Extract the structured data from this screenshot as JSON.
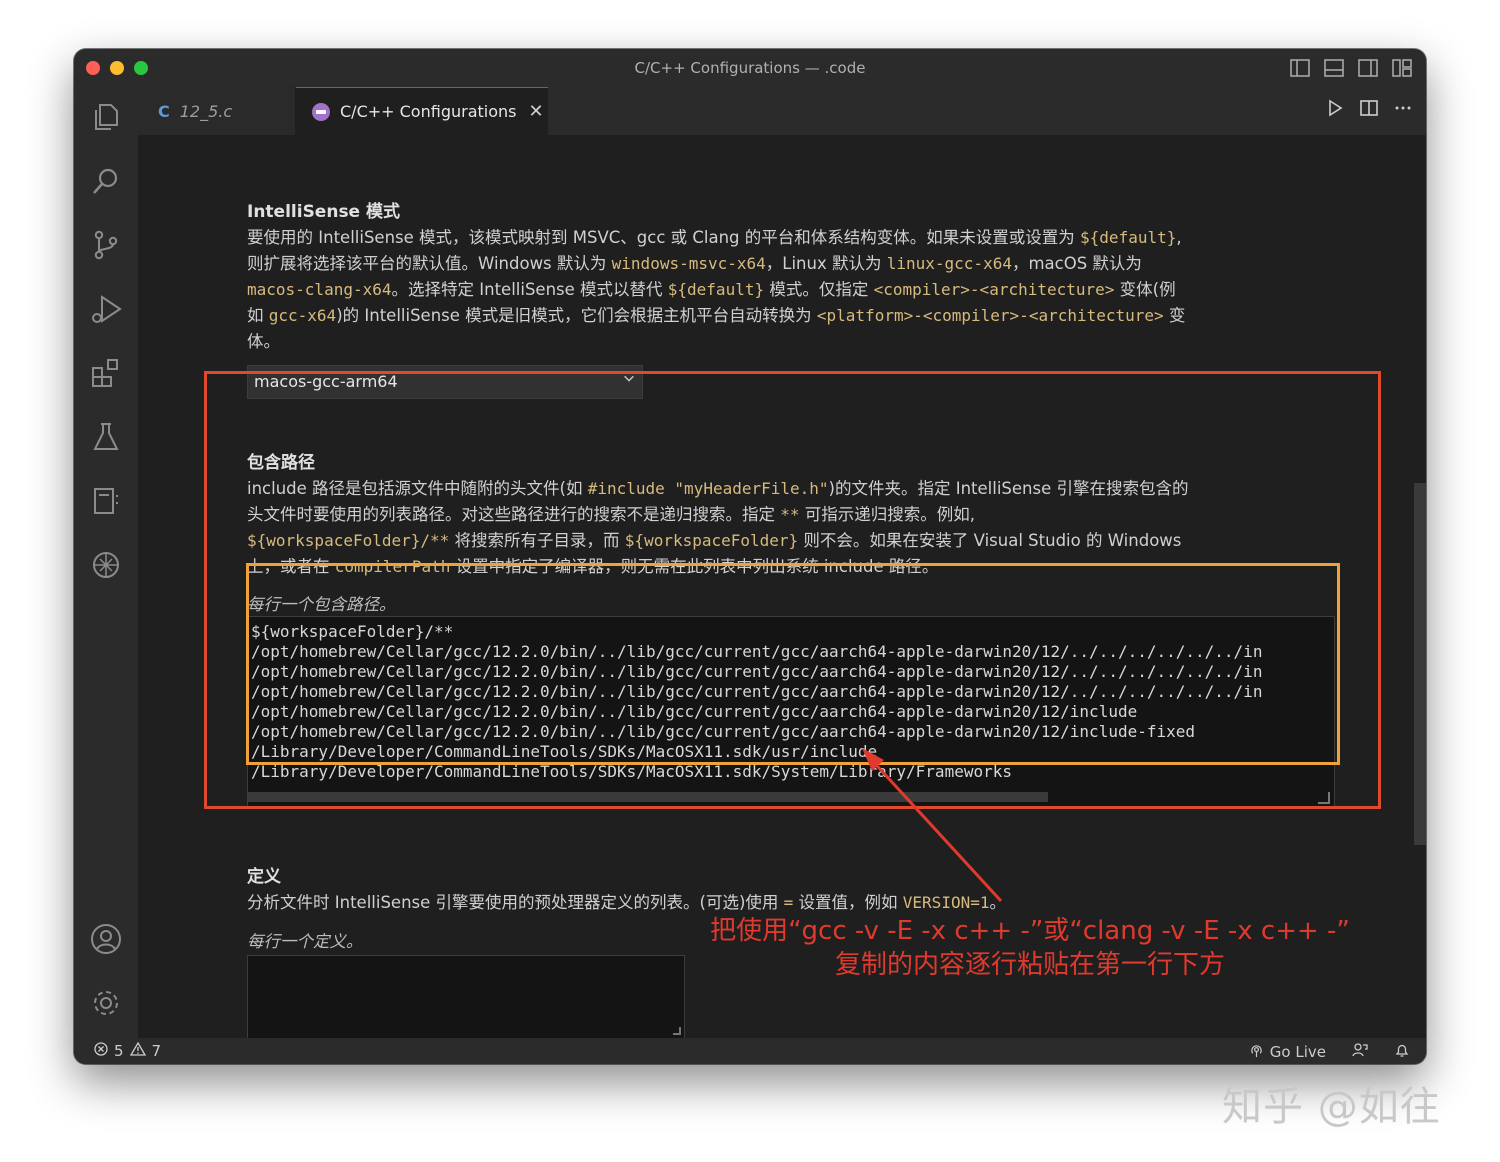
{
  "window": {
    "title": "C/C++ Configurations — .code",
    "traffic_colors": [
      "#ff5f57",
      "#febc2e",
      "#28c840"
    ]
  },
  "activity_bar": {
    "icons": [
      "explorer-icon",
      "search-icon",
      "source-control-icon",
      "run-debug-icon",
      "extensions-icon",
      "testing-icon",
      "notebook-icon",
      "openai-icon",
      "account-icon",
      "gear-icon"
    ]
  },
  "tabs": [
    {
      "label": "12_5.c",
      "glyph": "C"
    },
    {
      "label": "C/C++ Configurations",
      "close": "✕"
    }
  ],
  "intellisense": {
    "title": "IntelliSense 模式",
    "desc_lines": [
      [
        "要使用的 IntelliSense 模式，该模式映射到 MSVC、gcc 或 Clang 的平台和体系结构变体。如果未设置或设置为 ",
        "${default}",
        ","
      ],
      [
        "则扩展将选择该平台的默认值。Windows 默认为 ",
        "windows-msvc-x64",
        "，Linux 默认为 ",
        "linux-gcc-x64",
        "，macOS 默认为"
      ],
      [
        "",
        "macos-clang-x64",
        "。选择特定 IntelliSense 模式以替代 ",
        "${default}",
        " 模式。仅指定 ",
        "<compiler>-<architecture>",
        " 变体(例"
      ],
      [
        "如 ",
        "gcc-x64",
        ")的 IntelliSense 模式是旧模式，它们会根据主机平台自动转换为 ",
        "<platform>-<compiler>-<architecture>",
        " 变"
      ],
      [
        "体。"
      ]
    ],
    "selected": "macos-gcc-arm64"
  },
  "include": {
    "title": "包含路径",
    "desc_lines": [
      [
        "include 路径是包括源文件中随附的头文件(如 ",
        "#include \"myHeaderFile.h\"",
        ")的文件夹。指定 IntelliSense 引擎在搜索包含的"
      ],
      [
        "头文件时要使用的列表路径。对这些路径进行的搜索不是递归搜索。指定 ",
        "**",
        " 可指示递归搜索。例如,"
      ],
      [
        "",
        "${workspaceFolder}/**",
        " 将搜索所有子目录，而 ",
        "${workspaceFolder}",
        " 则不会。如果在安装了 Visual Studio 的 Windows"
      ],
      [
        "上，或者在 ",
        "compilerPath",
        " 设置中指定了编译器，则无需在此列表中列出系统 include 路径。"
      ]
    ],
    "hint": "每行一个包含路径。",
    "paths": [
      "${workspaceFolder}/**",
      "/opt/homebrew/Cellar/gcc/12.2.0/bin/../lib/gcc/current/gcc/aarch64-apple-darwin20/12/../../../../../../in",
      "/opt/homebrew/Cellar/gcc/12.2.0/bin/../lib/gcc/current/gcc/aarch64-apple-darwin20/12/../../../../../../in",
      "/opt/homebrew/Cellar/gcc/12.2.0/bin/../lib/gcc/current/gcc/aarch64-apple-darwin20/12/../../../../../../in",
      "/opt/homebrew/Cellar/gcc/12.2.0/bin/../lib/gcc/current/gcc/aarch64-apple-darwin20/12/include",
      "/opt/homebrew/Cellar/gcc/12.2.0/bin/../lib/gcc/current/gcc/aarch64-apple-darwin20/12/include-fixed",
      "/Library/Developer/CommandLineTools/SDKs/MacOSX11.sdk/usr/include",
      "/Library/Developer/CommandLineTools/SDKs/MacOSX11.sdk/System/Library/Frameworks"
    ]
  },
  "defines": {
    "title": "定义",
    "desc_lines": [
      [
        "分析文件时 IntelliSense 引擎要使用的预处理器定义的列表。(可选)使用 ",
        "=",
        " 设置值，例如 ",
        "VERSION=1",
        "。"
      ]
    ],
    "hint": "每行一个定义。"
  },
  "status": {
    "errors": "5",
    "warnings": "7",
    "go_live": "Go Live"
  },
  "annotation": {
    "line1": "把使用“gcc -v -E -x c++ -”或“clang -v -E -x c++ -”",
    "line2": "复制的内容逐行粘贴在第一行下方"
  },
  "watermark": "知乎 @如往",
  "colors": {
    "highlight_box": "#e04a2c",
    "textarea_box": "#f0a23a",
    "code_text": "#d7ba7d",
    "annotation": "#e03a2e"
  }
}
